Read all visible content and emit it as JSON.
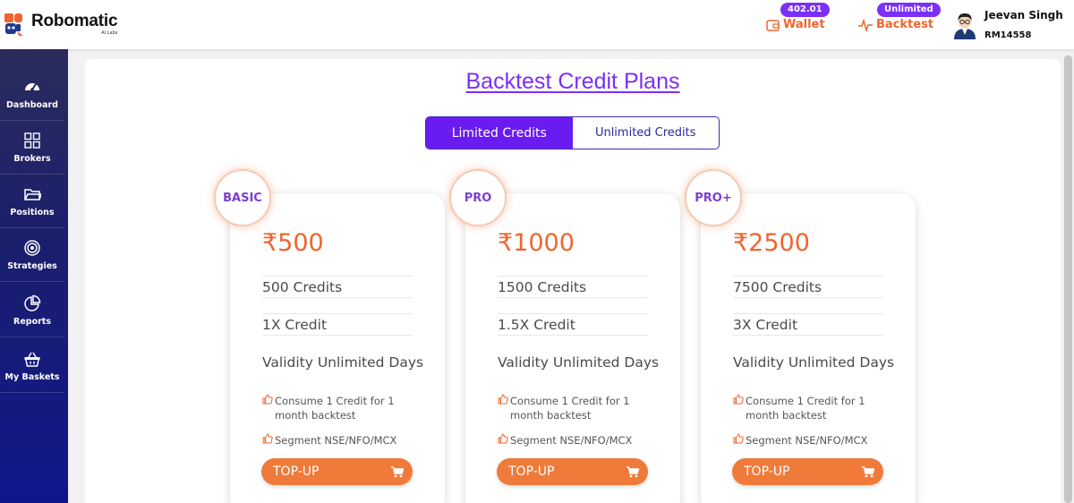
{
  "app": {
    "name": "Robomatic",
    "tagline": "AI Labs"
  },
  "header": {
    "wallet": {
      "badge": "402.01",
      "label": "Wallet"
    },
    "backtest": {
      "badge": "Unlimited",
      "label": "Backtest"
    },
    "user": {
      "name": "Jeevan Singh",
      "id": "RM14558"
    }
  },
  "sidebar": {
    "items": [
      {
        "label": "Dashboard",
        "icon": "gauge-icon"
      },
      {
        "label": "Brokers",
        "icon": "grid-icon"
      },
      {
        "label": "Positions",
        "icon": "folder-icon"
      },
      {
        "label": "Strategies",
        "icon": "target-icon"
      },
      {
        "label": "Reports",
        "icon": "pie-chart-icon"
      },
      {
        "label": "My Baskets",
        "icon": "basket-icon"
      }
    ]
  },
  "page": {
    "title": "Backtest Credit Plans",
    "tabs": [
      {
        "label": "Limited Credits",
        "active": true
      },
      {
        "label": "Unlimited Credits",
        "active": false
      }
    ]
  },
  "plans": [
    {
      "name": "BASIC",
      "price": "₹500",
      "credits": "500 Credits",
      "multiplier": "1X Credit",
      "validity": "Validity Unlimited Days",
      "note1": "Consume 1 Credit for 1 month backtest",
      "note2": "Segment NSE/NFO/MCX",
      "button": "TOP-UP"
    },
    {
      "name": "PRO",
      "price": "₹1000",
      "credits": "1500 Credits",
      "multiplier": "1.5X Credit",
      "validity": "Validity Unlimited Days",
      "note1": "Consume 1 Credit for 1 month backtest",
      "note2": "Segment NSE/NFO/MCX",
      "button": "TOP-UP"
    },
    {
      "name": "PRO+",
      "price": "₹2500",
      "credits": "7500 Credits",
      "multiplier": "3X Credit",
      "validity": "Validity Unlimited Days",
      "note1": "Consume 1 Credit for 1 month backtest",
      "note2": "Segment NSE/NFO/MCX",
      "button": "TOP-UP"
    }
  ],
  "colors": {
    "accent": "#7b2ff7",
    "orange": "#f0652f",
    "sidebar": "#1b1f6b"
  }
}
